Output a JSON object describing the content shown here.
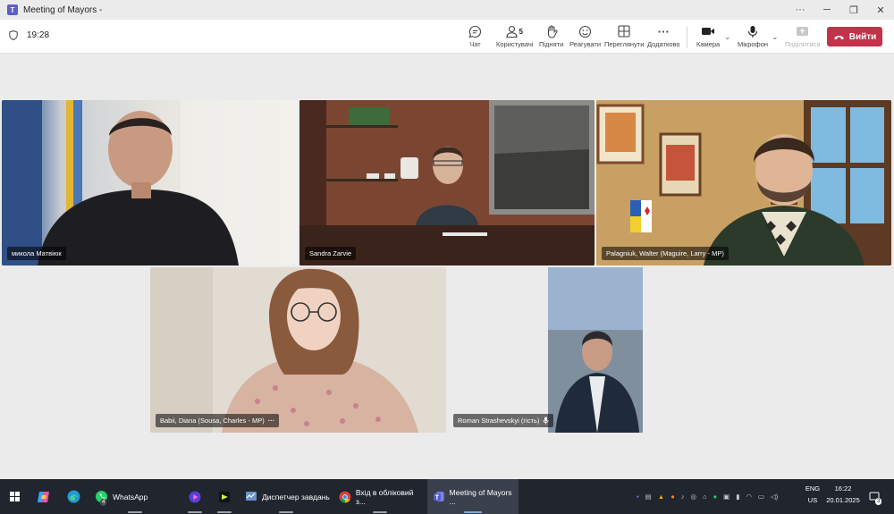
{
  "window": {
    "title": "Meeting of Mayors -",
    "app_icon": "teams-icon"
  },
  "toolbar": {
    "timer": "19:28",
    "participants_count": "5",
    "chat": "Чат",
    "people": "Користувачі",
    "raise": "Підняти",
    "react": "Реагувати",
    "view": "Переглянути",
    "more": "Додатково",
    "camera": "Камера",
    "mic": "Мікрофон",
    "share": "Поділитися",
    "leave": "Вийти",
    "accent_color": "#c4314b"
  },
  "participants": [
    {
      "name": "микола Матвіюк"
    },
    {
      "name": "Sandra Zarvie"
    },
    {
      "name": "Palagniuk, Walter (Maguire, Larry - MP)"
    },
    {
      "name": "Babii, Diana (Sousa, Charles - MP)"
    },
    {
      "name": "Roman Strashevskyi (гість)"
    }
  ],
  "taskbar": {
    "whatsapp": "WhatsApp",
    "whatsapp_badge": "4",
    "task_manager": "Диспетчер завдань",
    "chrome": "Вхід в обліковий з...",
    "teams": "Meeting of Mayors ...",
    "lang_top": "ENG",
    "lang_bottom": "US",
    "time": "16:22",
    "date": "20.01.2025",
    "notif_count": "3"
  }
}
